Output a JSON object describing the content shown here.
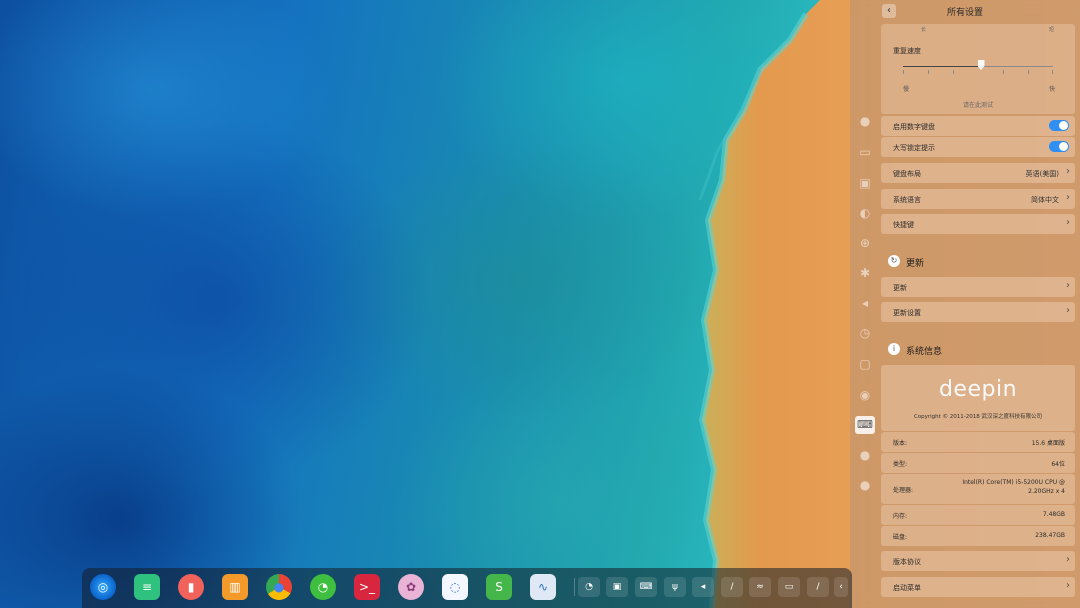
{
  "settings": {
    "title": "所有设置",
    "back_icon": "chevron-left-icon",
    "speed_top_labels": [
      "长",
      "短"
    ],
    "repeat_speed_label": "重复速度",
    "speed_slow": "慢",
    "speed_fast": "快",
    "speed_level": 0.52,
    "speed_test": "请在此测试",
    "numpad_label": "启用数字键盘",
    "numpad_on": true,
    "capslock_label": "大写锁定提示",
    "capslock_on": true,
    "layout_label": "键盘布局",
    "layout_value": "英语(美国)",
    "language_label": "系统语言",
    "language_value": "简体中文",
    "shortcuts_label": "快捷键",
    "update_section": "更新",
    "update_label": "更新",
    "update_settings_label": "更新设置",
    "sysinfo_section": "系统信息",
    "logo_text": "deepin",
    "copyright": "Copyright © 2011-2018 武汉深之度科技有限公司",
    "info": [
      {
        "label": "版本:",
        "value": "15.6 桌面版"
      },
      {
        "label": "类型:",
        "value": "64位"
      },
      {
        "label": "处理器:",
        "value": "Intel(R) Core(TM) i5-5200U CPU @",
        "value2": "2.20GHz x 4"
      },
      {
        "label": "内存:",
        "value": "7.48GB"
      },
      {
        "label": "磁盘:",
        "value": "238.47GB"
      }
    ],
    "license_label": "版本协议",
    "boot_menu_label": "启动菜单",
    "nav_icons": [
      "user-icon",
      "display-icon",
      "calendar-icon",
      "theme-icon",
      "network-icon",
      "bluetooth-icon",
      "sound-icon",
      "clock-icon",
      "power-icon",
      "mouse-icon",
      "keyboard-icon",
      "update-icon",
      "info-icon"
    ]
  },
  "dock": {
    "apps": [
      "deepin-launcher-icon",
      "file-manager-icon",
      "screen-recorder-icon",
      "app-store-icon",
      "chrome-icon",
      "wechat-icon",
      "terminal-icon",
      "settings-icon",
      "chat-icon",
      "slides-icon",
      "system-monitor-icon"
    ],
    "tray": [
      "wechat-tray-icon",
      "screenshot-icon",
      "keyboard-tray-icon",
      "usb-icon",
      "volume-icon",
      "pen-icon",
      "wifi-icon",
      "battery-icon",
      "brush-icon",
      "more-icon"
    ]
  },
  "colors": {
    "toggle_on": "#2f8ff3",
    "panel_tint": "#c4966e"
  }
}
